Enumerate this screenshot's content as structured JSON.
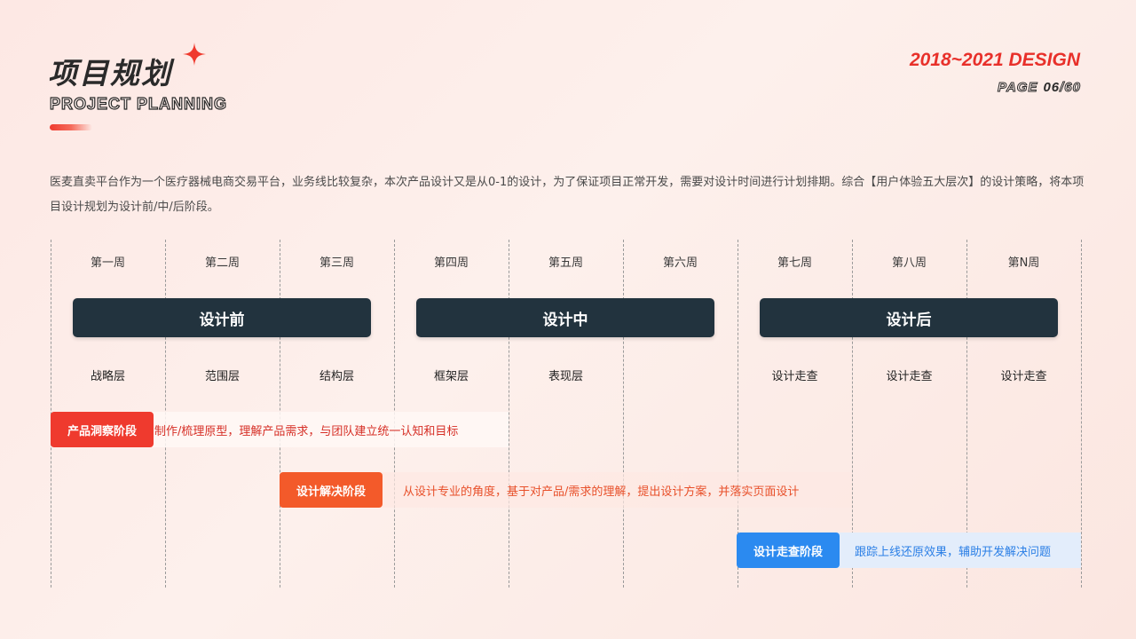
{
  "header": {
    "title_cn": "项目规划",
    "title_en": "PROJECT PLANNING",
    "year_design": "2018~2021 DESIGN",
    "page_label": "PAGE",
    "page_current": "06",
    "page_total": "/60"
  },
  "intro": "医麦直卖平台作为一个医疗器械电商交易平台，业务线比较复杂，本次产品设计又是从0-1的设计，为了保证项目正常开发，需要对设计时间进行计划排期。综合【用户体验五大层次】的设计策略，将本项目设计规划为设计前/中/后阶段。",
  "weeks": [
    "第一周",
    "第二周",
    "第三周",
    "第四周",
    "第五周",
    "第六周",
    "第七周",
    "第八周",
    "第N周"
  ],
  "phases": [
    "设计前",
    "设计中",
    "设计后"
  ],
  "layers": [
    "战略层",
    "范围层",
    "结构层",
    "框架层",
    "表现层",
    "",
    "设计走查",
    "设计走查",
    "设计走查"
  ],
  "stages": [
    {
      "label": "产品洞察阶段",
      "desc": "制作/梳理原型，理解产品需求，与团队建立统一认知和目标"
    },
    {
      "label": "设计解决阶段",
      "desc": "从设计专业的角度，基于对产品/需求的理解，提出设计方案，并落实页面设计"
    },
    {
      "label": "设计走查阶段",
      "desc": "跟踪上线还原效果，辅助开发解决问题"
    }
  ],
  "colors": {
    "accent_red": "#ef3a2e",
    "accent_orange": "#f35a2a",
    "accent_blue": "#2b8af0",
    "phase_dark": "#22333e"
  }
}
